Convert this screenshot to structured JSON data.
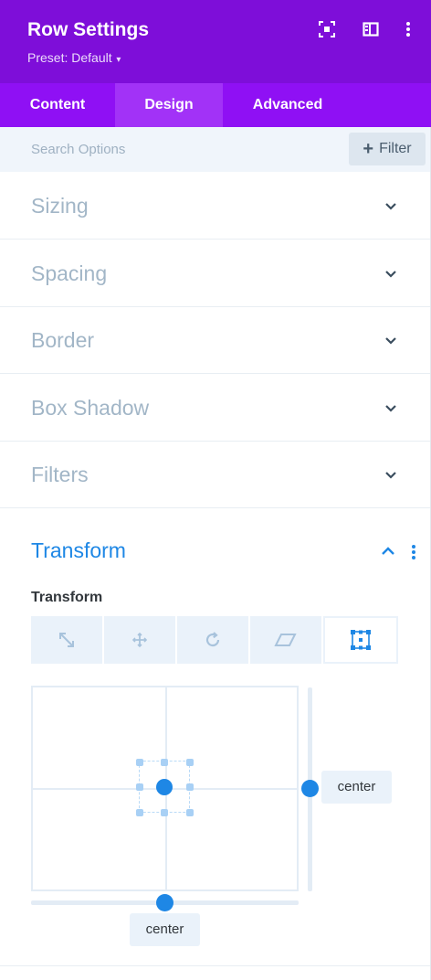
{
  "header": {
    "title": "Row Settings",
    "preset_label": "Preset: Default",
    "icons": [
      "focus-icon",
      "split-view-icon",
      "more-vertical-icon"
    ],
    "bg_color": "#7e0ed9"
  },
  "tabs": [
    {
      "label": "Content",
      "active": false
    },
    {
      "label": "Design",
      "active": true
    },
    {
      "label": "Advanced",
      "active": false
    }
  ],
  "search": {
    "placeholder": "Search Options",
    "filter_label": "Filter"
  },
  "sections": [
    {
      "label": "Sizing",
      "expanded": false
    },
    {
      "label": "Spacing",
      "expanded": false
    },
    {
      "label": "Border",
      "expanded": false
    },
    {
      "label": "Box Shadow",
      "expanded": false
    },
    {
      "label": "Filters",
      "expanded": false
    }
  ],
  "transform": {
    "title": "Transform",
    "field_label": "Transform",
    "buttons": [
      {
        "icon": "scale-icon",
        "active": false
      },
      {
        "icon": "translate-icon",
        "active": false
      },
      {
        "icon": "rotate-icon",
        "active": false
      },
      {
        "icon": "skew-icon",
        "active": false
      },
      {
        "icon": "origin-icon",
        "active": true
      }
    ],
    "origin_x": "center",
    "origin_y": "center",
    "accent_color": "#1e87e5"
  }
}
